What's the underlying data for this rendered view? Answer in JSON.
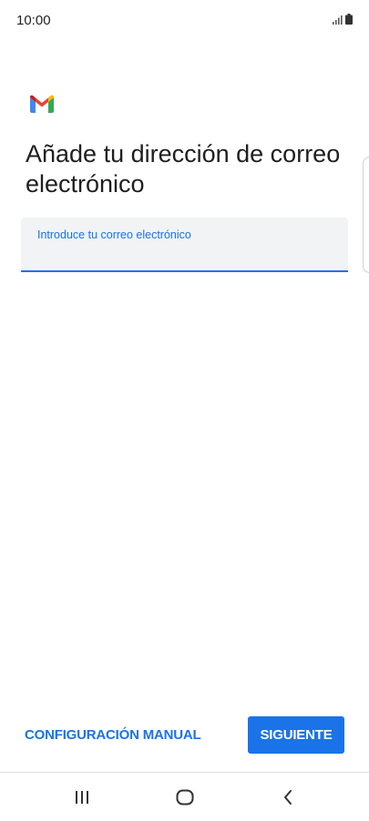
{
  "status_bar": {
    "time": "10:00",
    "icons": [
      "signal-icon",
      "battery-icon"
    ]
  },
  "app": {
    "logo": "gmail-logo-icon"
  },
  "screen": {
    "title": "Añade tu dirección de correo electrónico",
    "email_field": {
      "label": "Introduce tu correo electrónico",
      "value": ""
    }
  },
  "actions": {
    "manual_config_label": "CONFIGURACIÓN MANUAL",
    "next_label": "SIGUIENTE"
  },
  "nav_bar": {
    "items": [
      "recent-apps-icon",
      "home-icon",
      "back-icon"
    ]
  },
  "colors": {
    "accent": "#1a73e8",
    "field_background": "#f1f3f4",
    "text_primary": "#1f1f1f"
  }
}
